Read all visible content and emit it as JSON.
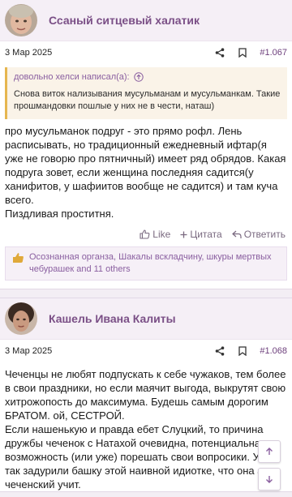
{
  "posts": [
    {
      "author": "Ссаный ситцевый халатик",
      "date": "3 Мар 2025",
      "number": "#1.067",
      "quote": {
        "header": "довольно хелси написал(а):",
        "text": "Снова виток нализывания мусульманам и мусульманкам. Такие прошмандовки пошлые у них не в чести, наташ)"
      },
      "paragraphs": [
        "про мусульманок подруг - это прямо рофл. Лень расписывать, но традиционный ежедневный ифтар(я уже не говорю про пятничный) имеет ряд обрядов. Какая подруга зовет, если женщина последняя садится(у ханифитов, у шафиитов вообще не садится) и там куча всего.",
        "Пиздливая проститня."
      ],
      "actions": {
        "like": "Like",
        "quote": "Цитата",
        "reply": "Ответить"
      },
      "likes": "Осознанная органза, Шакалы вскладчину, шкуры мертвых чебурашек and 11 others"
    },
    {
      "author": "Кашель Ивана Калиты",
      "date": "3 Мар 2025",
      "number": "#1.068",
      "paragraphs": [
        "Чеченцы не любят подпускать к себе чужаков, тем более в свои праздники, но если маячит выгода, выкрутят свою хитрожопость до максимума. Будешь самым дорогим БРАТОМ. ой, СЕСТРОЙ.",
        "Если нашенькую и правда ебет Слуцкий, то причина дружбы чеченок с Натахой очевидна, потенциальная возможность (или уже) порешать свои вопросики. Уже так задурили башку этой наивной идиотке, что она аж чеченский учит."
      ]
    }
  ],
  "colors": {
    "accent": "#7a4f86",
    "quote_bar": "#e6b64f"
  },
  "icons": [
    "share-icon",
    "bookmark-icon",
    "arrow-up-circle-icon",
    "thumbs-up-icon",
    "plus-icon",
    "reply-icon",
    "chevron-up-icon",
    "chevron-down-icon"
  ]
}
